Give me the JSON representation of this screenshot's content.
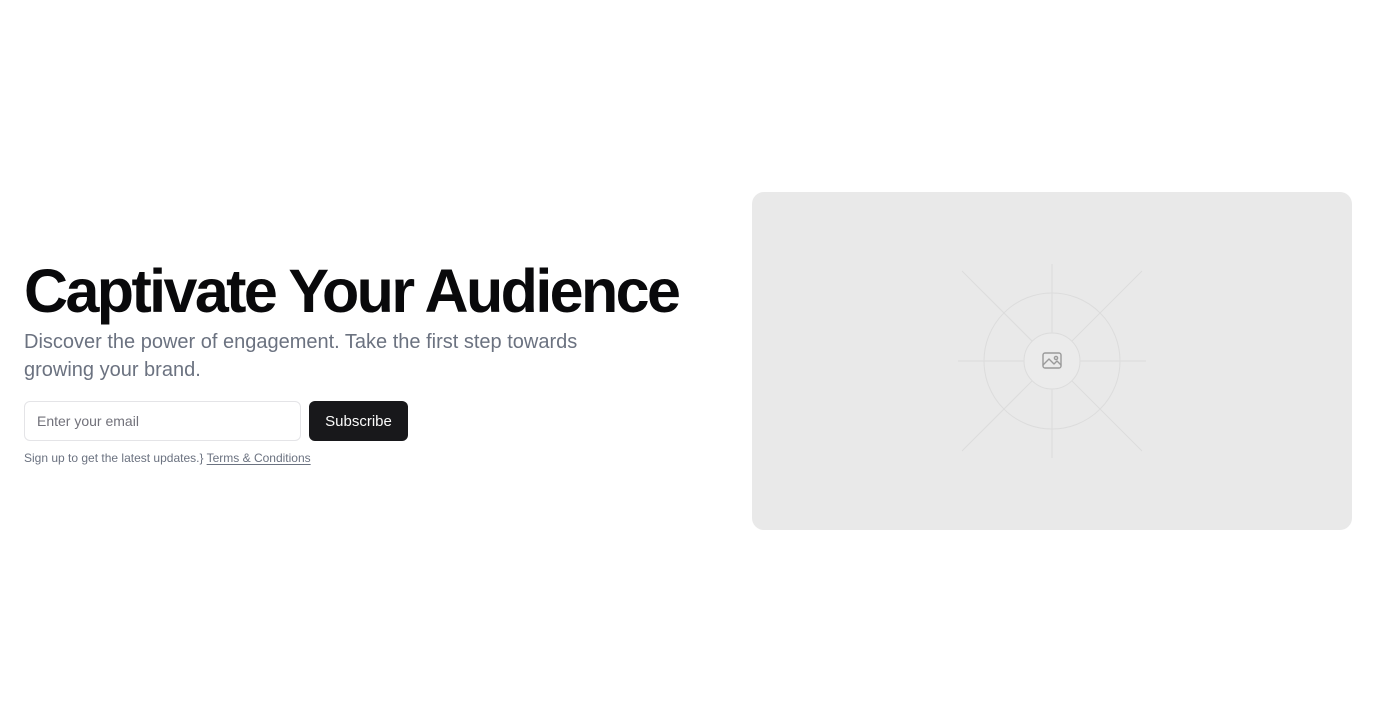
{
  "hero": {
    "title": "Captivate Your Audience",
    "subtitle": "Discover the power of engagement. Take the first step towards growing your brand.",
    "email_placeholder": "Enter your email",
    "subscribe_label": "Subscribe",
    "note_text": "Sign up to get the latest updates.",
    "note_brace": "}",
    "terms_link": "Terms & Conditions"
  },
  "image": {
    "icon": "image-icon"
  },
  "colors": {
    "title": "#09090b",
    "muted_text": "#6b7280",
    "button_bg": "#18181b",
    "button_text": "#fafafa",
    "placeholder_bg": "#e9e9e9"
  }
}
